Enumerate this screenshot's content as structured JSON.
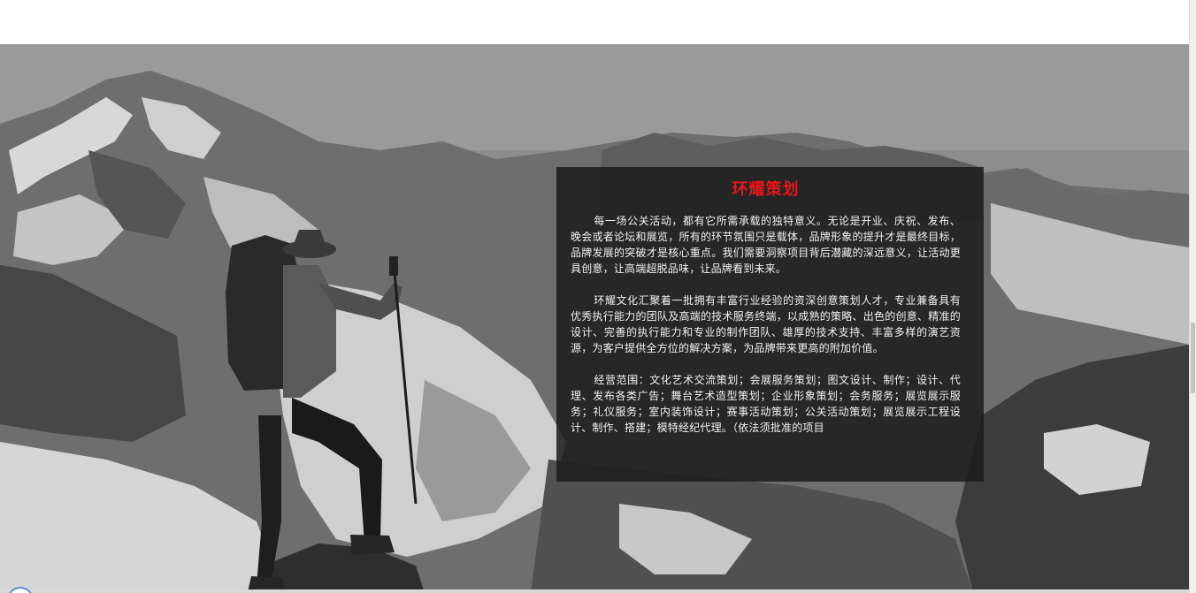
{
  "panel": {
    "title": "环耀策划",
    "title_color": "#e5161a",
    "paragraphs": [
      "每一场公关活动，都有它所需承载的独特意义。无论是开业、庆祝、发布、晚会或者论坛和展览，所有的环节氛围只是载体，品牌形象的提升才是最终目标，品牌发展的突破才是核心重点。我们需要洞察项目背后潜藏的深远意义，让活动更具创意，让高端超脱品味，让品牌看到未来。",
      "环耀文化汇聚着一批拥有丰富行业经验的资深创意策划人才，专业兼备具有优秀执行能力的团队及高端的技术服务终端，以成熟的策略、出色的创意、精准的设计、完善的执行能力和专业的制作团队、雄厚的技术支持、丰富多样的演艺资源，为客户提供全方位的解决方案，为品牌带来更高的附加价值。",
      "经营范围：文化艺术交流策划；会展服务策划；图文设计、制作；设计、代理、发布各类广告；舞台艺术造型策划；企业形象策划；会务服务；展览展示服务；礼仪服务；室内装饰设计；赛事活动策划；公关活动策划；展览展示工程设计、制作、搭建；模特经纪代理。（依法须批准的项目"
    ]
  },
  "hero": {
    "image": "mountain-hiker-background"
  }
}
